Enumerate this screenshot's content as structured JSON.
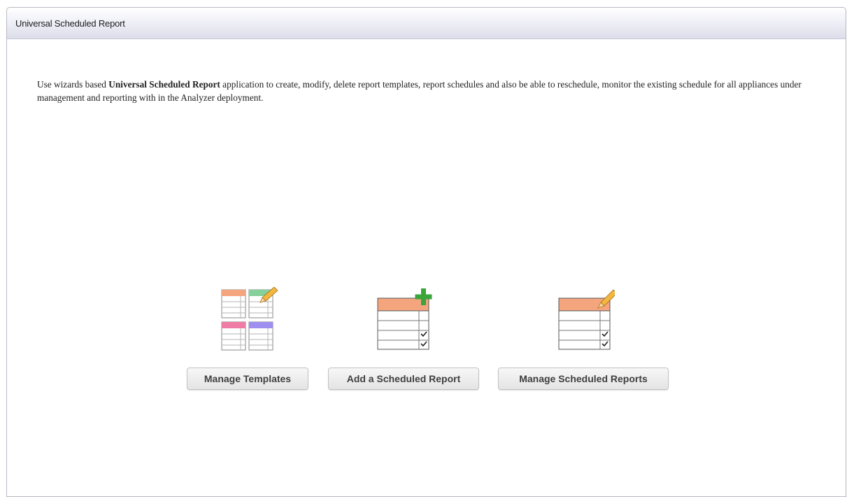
{
  "panel": {
    "title": "Universal Scheduled Report"
  },
  "intro": {
    "prefix": "Use wizards based ",
    "bold": "Universal Scheduled Report",
    "suffix": " application to create, modify, delete report templates, report schedules and also be able to reschedule, monitor the existing schedule for all appliances under management and reporting with in the Analyzer deployment."
  },
  "actions": [
    {
      "label": "Manage Templates",
      "icon": "templates-grid-icon"
    },
    {
      "label": "Add a Scheduled Report",
      "icon": "add-report-icon"
    },
    {
      "label": "Manage Scheduled Reports",
      "icon": "edit-report-icon"
    }
  ],
  "colors": {
    "header_top": "#ffffff",
    "header_bottom": "#dcdde9",
    "panel_border": "#b9b9c4",
    "orange_header": "#f5a57e",
    "green_header": "#86d19a",
    "pink_header": "#ef7ca4",
    "purple_header": "#9d8ef0",
    "plus_green": "#3aa53a"
  }
}
